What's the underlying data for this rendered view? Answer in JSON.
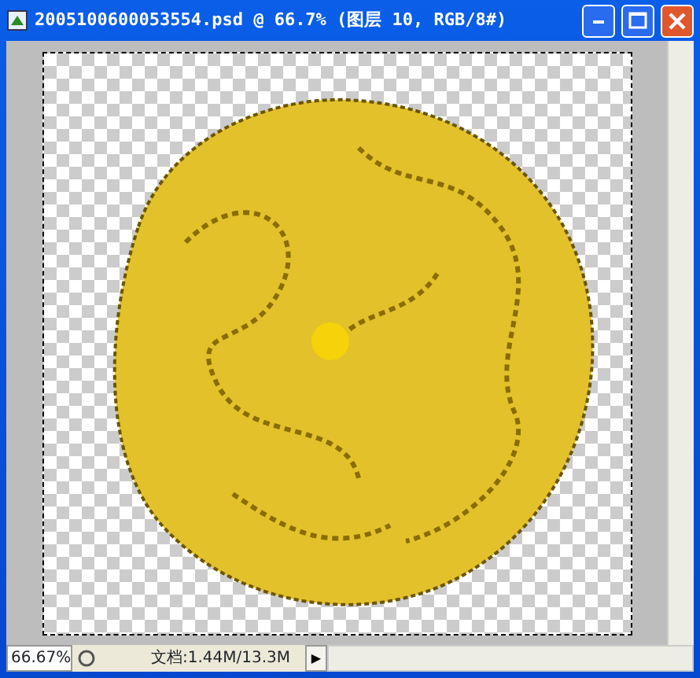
{
  "window": {
    "title": "2005100600053554.psd @ 66.7% (图层 10, RGB/8#)"
  },
  "status_bar": {
    "zoom": "66.67%",
    "document_info": "文档:1.44M/13.3M",
    "menu_arrow": "▶"
  }
}
